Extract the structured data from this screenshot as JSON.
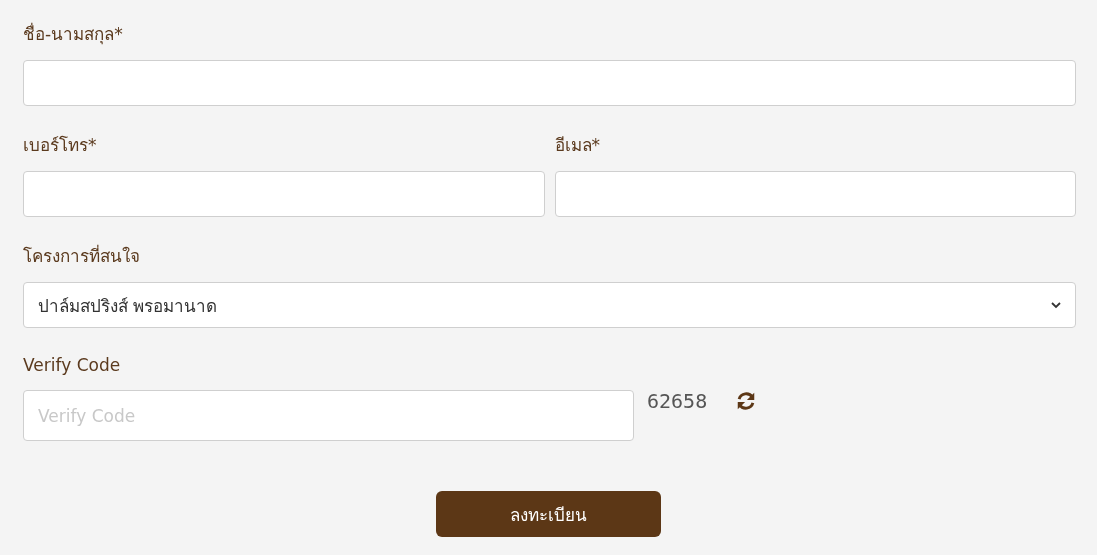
{
  "rows": [
    [
      {
        "kind": "text",
        "label": "ชื่อ-นามสกุล*"
      }
    ],
    [
      {
        "kind": "text",
        "label": "เบอร์โทร*"
      },
      {
        "kind": "text",
        "label": "อีเมล*"
      }
    ],
    [
      {
        "kind": "select",
        "label": "โครงการที่สนใจ",
        "value": "ปาล์มสปริงส์ พรอมานาด"
      }
    ]
  ],
  "verify": {
    "label": "Verify Code",
    "placeholder": "Verify Code",
    "code": "62658"
  },
  "submit": {
    "label": "ลงทะเบียน"
  }
}
